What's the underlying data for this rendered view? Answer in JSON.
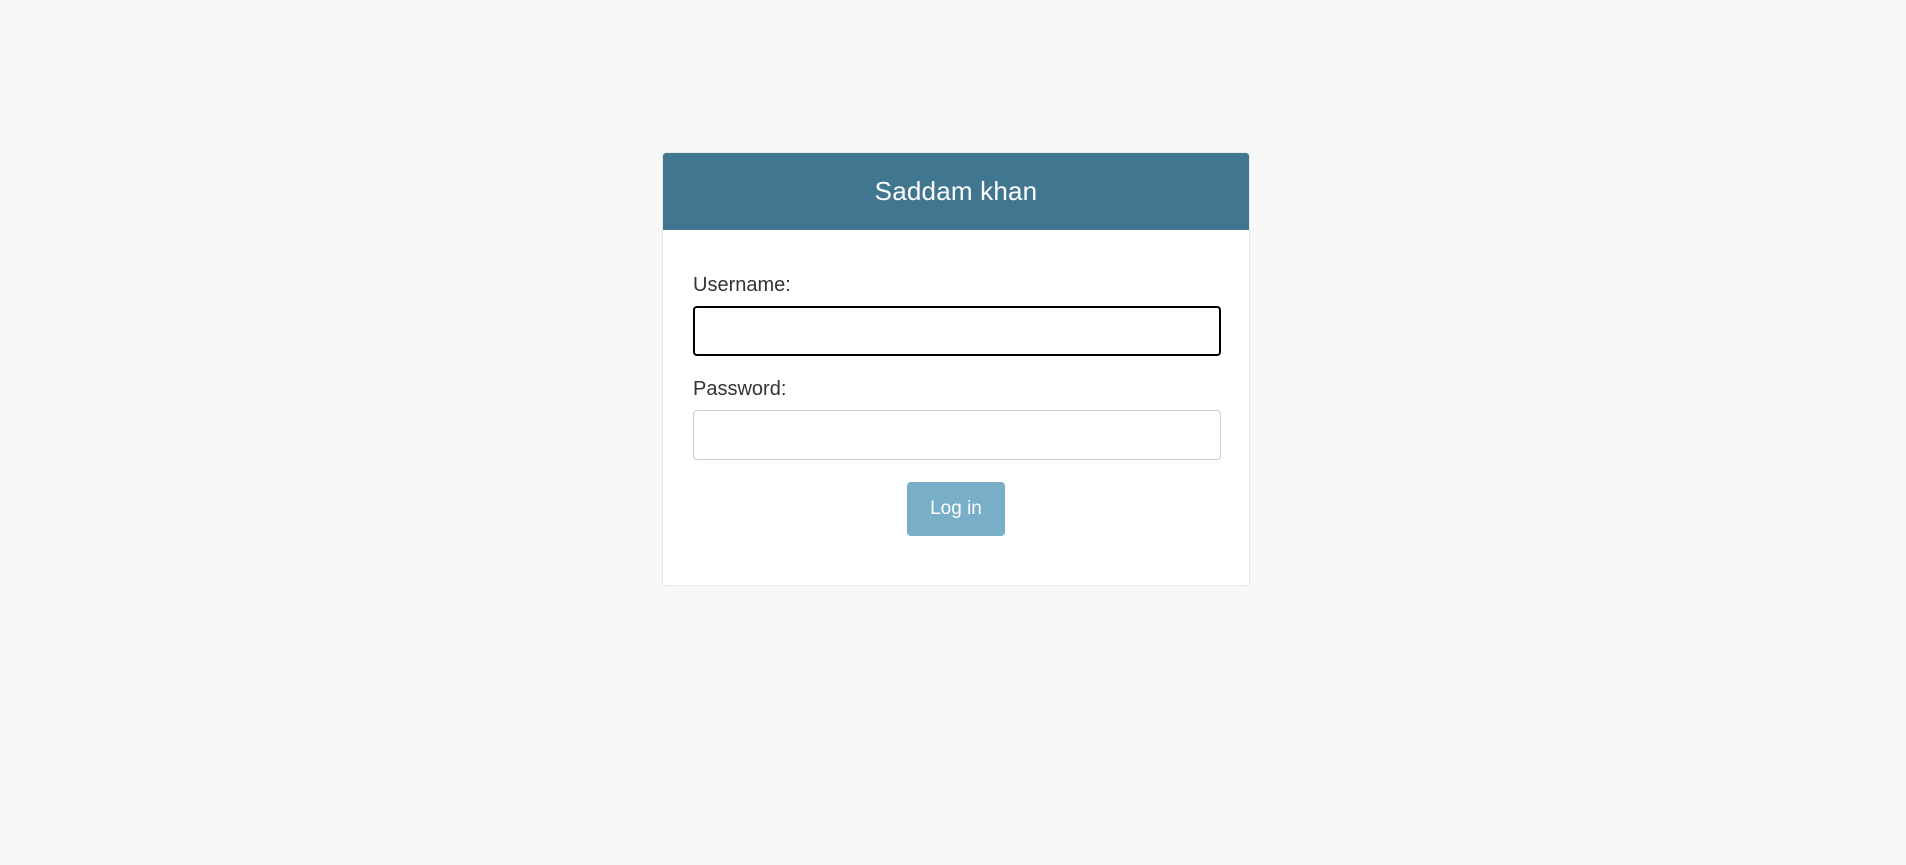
{
  "header": {
    "title": "Saddam khan"
  },
  "form": {
    "username_label": "Username:",
    "username_value": "",
    "password_label": "Password:",
    "password_value": "",
    "submit_label": "Log in"
  },
  "colors": {
    "page_background": "#f8f8f8",
    "header_background": "#417690",
    "button_background": "#79aec8"
  }
}
